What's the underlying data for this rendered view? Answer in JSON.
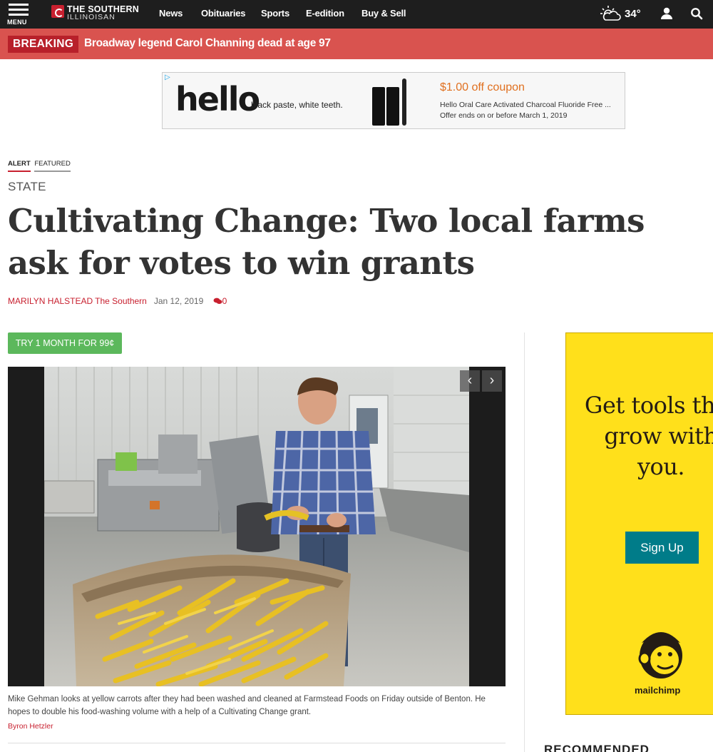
{
  "nav": {
    "menu_label": "MENU",
    "logo_line1": "THE SOUTHERN",
    "logo_line2": "ILLINOISAN",
    "links": [
      "News",
      "Obituaries",
      "Sports",
      "E-edition",
      "Buy & Sell"
    ],
    "temperature": "34°"
  },
  "breaking": {
    "label": "BREAKING",
    "headline": "Broadway legend Carol Channing dead at age 97"
  },
  "ad_top": {
    "brand": "hello",
    "tagline": "black paste, white teeth.",
    "offer": "$1.00 off coupon",
    "description": "Hello Oral Care Activated Charcoal Fluoride Free ...",
    "expiry": "Offer ends on or before March 1, 2019"
  },
  "article": {
    "flags": [
      "ALERT",
      "FEATURED"
    ],
    "section": "STATE",
    "title": "Cultivating Change: Two local farms ask for votes to win grants",
    "author": "MARILYN HALSTEAD",
    "publication": "The Southern",
    "date": "Jan 12, 2019",
    "comment_count": "0",
    "subscribe_label": "TRY 1 MONTH FOR 99¢",
    "caption": "Mike Gehman looks at yellow carrots after they had been washed and cleaned at Farmstead Foods on Friday outside of Benton. He hopes to double his food-washing volume with a help of a Cultivating Change grant.",
    "photo_credit": "Byron Hetzler"
  },
  "ad_side": {
    "headline": "Get tools that grow with you.",
    "button": "Sign Up",
    "brand": "mailchimp"
  },
  "recommended_label": "RECOMMENDED",
  "colors": {
    "topbar": "#1e1e1e",
    "breaking": "#d9534f",
    "accent_red": "#c8202f",
    "subscribe_green": "#5cb85c",
    "mailchimp_yellow": "#ffe01b",
    "mailchimp_teal": "#007c89"
  }
}
